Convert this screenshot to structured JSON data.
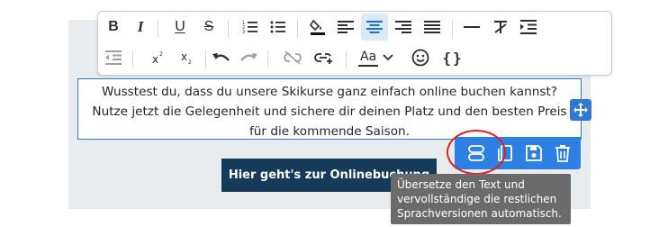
{
  "colors": {
    "accent": "#2f80e4",
    "selection_border": "#2f78d4",
    "cta_background": "#163a5a",
    "tooltip_background": "#6b6b6b",
    "highlight_circle": "#e02020",
    "active_button_background": "#dce9f8"
  },
  "toolbar": {
    "row1": [
      {
        "icon": "bold-icon",
        "label": "B",
        "active": false
      },
      {
        "icon": "italic-icon",
        "label": "I",
        "active": false
      },
      {
        "icon": "underline-icon",
        "label": "U",
        "active": false
      },
      {
        "icon": "strikethrough-icon",
        "label": "S",
        "active": false
      },
      {
        "icon": "ordered-list-icon",
        "active": false
      },
      {
        "icon": "unordered-list-icon",
        "active": false
      },
      {
        "icon": "fill-color-icon",
        "active": false
      },
      {
        "icon": "align-left-icon",
        "active": false
      },
      {
        "icon": "align-center-icon",
        "active": true
      },
      {
        "icon": "align-right-icon",
        "active": false
      },
      {
        "icon": "align-justify-icon",
        "active": false
      },
      {
        "icon": "horizontal-line-icon",
        "active": false
      },
      {
        "icon": "clear-format-icon",
        "active": false
      },
      {
        "icon": "indent-icon",
        "active": false
      }
    ],
    "row2": [
      {
        "icon": "outdent-icon",
        "active": false
      },
      {
        "icon": "superscript-icon",
        "active": false
      },
      {
        "icon": "subscript-icon",
        "active": false
      },
      {
        "icon": "undo-icon",
        "active": false
      },
      {
        "icon": "redo-icon",
        "active": false
      },
      {
        "icon": "unlink-icon",
        "active": false
      },
      {
        "icon": "add-link-icon",
        "active": false
      },
      {
        "icon": "font-size-icon",
        "active": false
      },
      {
        "icon": "emoji-icon",
        "active": false
      },
      {
        "icon": "code-braces-icon",
        "active": false
      }
    ],
    "font_size_label": "Aa"
  },
  "editor": {
    "text": "Wusstest du, dass du unsere Skikurse ganz einfach online buchen kannst? Nutze jetzt die Gelegenheit und sichere dir deinen Platz und den besten Preis für die kommende Saison."
  },
  "cta": {
    "label": "Hier geht's zur Onlinebuchung"
  },
  "actions": [
    {
      "icon": "translate-icon"
    },
    {
      "icon": "copy-icon"
    },
    {
      "icon": "save-icon"
    },
    {
      "icon": "delete-icon"
    }
  ],
  "tooltip": {
    "lines": [
      "Übersetze den Text und",
      "vervollständige die restlichen",
      "Sprachversionen automatisch."
    ]
  }
}
